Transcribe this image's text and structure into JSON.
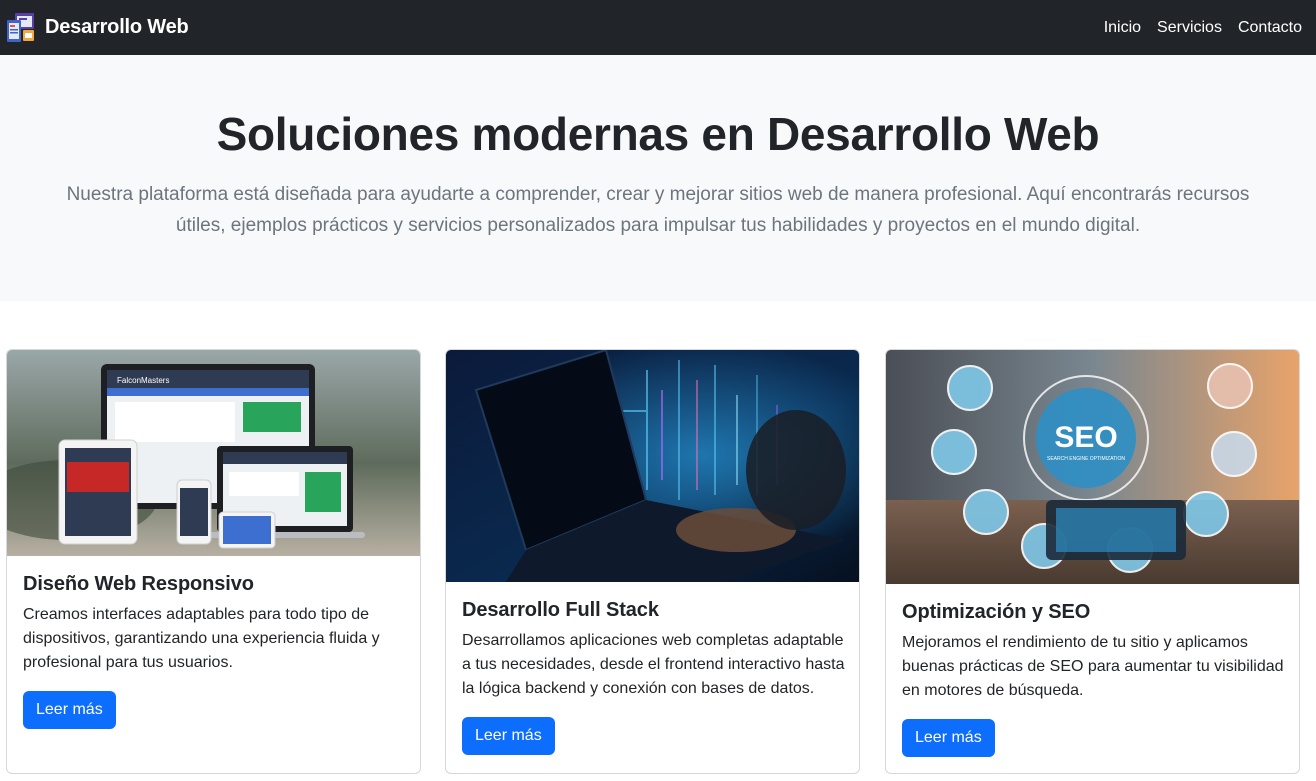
{
  "navbar": {
    "brand": "Desarrollo Web",
    "links": [
      "Inicio",
      "Servicios",
      "Contacto"
    ],
    "logo_icon": "web-pages-icon"
  },
  "hero": {
    "title": "Soluciones modernas en Desarrollo Web",
    "lead": "Nuestra plataforma está diseñada para ayudarte a comprender, crear y mejorar sitios web de manera profesional. Aquí encontrarás recursos útiles, ejemplos prácticos y servicios personalizados para impulsar tus habilidades y proyectos en el mundo digital."
  },
  "cards": [
    {
      "title": "Diseño Web Responsivo",
      "text": "Creamos interfaces adaptables para todo tipo de dispositivos, garantizando una experiencia fluida y profesional para tus usuarios.",
      "button": "Leer más",
      "image_label": "FalconMasters",
      "image_subject": "responsive-devices"
    },
    {
      "title": "Desarrollo Full Stack",
      "text": "Desarrollamos aplicaciones web completas adaptable a tus necesidades, desde el frontend interactivo hasta la lógica backend y conexión con bases de datos.",
      "button": "Leer más",
      "image_subject": "laptop-code"
    },
    {
      "title": "Optimización y SEO",
      "text": "Mejoramos el rendimiento de tu sitio y aplicamos buenas prácticas de SEO para aumentar tu visibilidad en motores de búsqueda.",
      "button": "Leer más",
      "image_label": "SEO",
      "image_sublabel": "SEARCH ENGINE OPTIMIZATION",
      "image_subject": "seo-icons"
    }
  ],
  "colors": {
    "navbar_bg": "#212529",
    "hero_bg": "#f8f9fa",
    "primary": "#0d6efd",
    "muted": "#6c757d"
  }
}
